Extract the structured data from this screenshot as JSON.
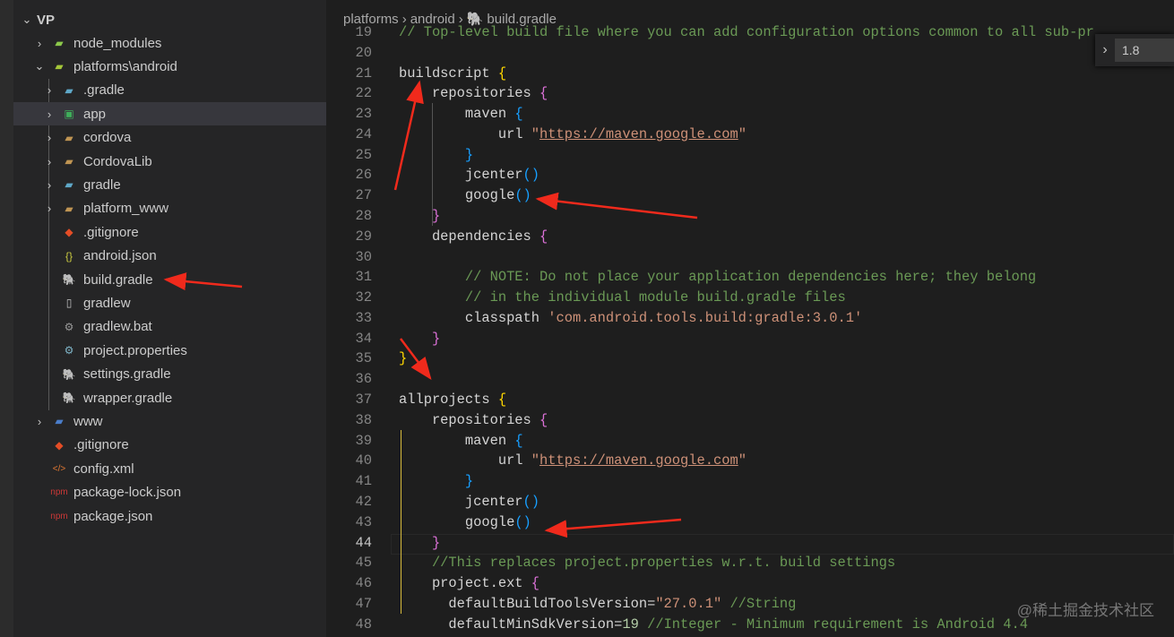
{
  "explorer": {
    "root": "VP",
    "items": [
      {
        "label": "node_modules",
        "icon": "node-folder-icon",
        "depth": 1,
        "expand": "closed"
      },
      {
        "label": "platforms\\android",
        "icon": "android-folder-icon",
        "depth": 1,
        "expand": "open"
      },
      {
        "label": ".gradle",
        "icon": "gradle-folder-icon",
        "depth": 2,
        "expand": "closed"
      },
      {
        "label": "app",
        "icon": "app-folder-icon",
        "depth": 2,
        "expand": "closed",
        "selected": true
      },
      {
        "label": "cordova",
        "icon": "folder-icon",
        "depth": 2,
        "expand": "closed"
      },
      {
        "label": "CordovaLib",
        "icon": "folder-icon",
        "depth": 2,
        "expand": "closed"
      },
      {
        "label": "gradle",
        "icon": "gradle-folder-icon",
        "depth": 2,
        "expand": "closed"
      },
      {
        "label": "platform_www",
        "icon": "folder-icon",
        "depth": 2,
        "expand": "closed"
      },
      {
        "label": ".gitignore",
        "icon": "git-icon",
        "depth": 2
      },
      {
        "label": "android.json",
        "icon": "json-icon",
        "depth": 2
      },
      {
        "label": "build.gradle",
        "icon": "gradle-file-icon",
        "depth": 2
      },
      {
        "label": "gradlew",
        "icon": "file-icon",
        "depth": 2
      },
      {
        "label": "gradlew.bat",
        "icon": "gears-icon",
        "depth": 2
      },
      {
        "label": "project.properties",
        "icon": "gear-icon",
        "depth": 2
      },
      {
        "label": "settings.gradle",
        "icon": "gradle-file-icon",
        "depth": 2
      },
      {
        "label": "wrapper.gradle",
        "icon": "gradle-file-icon",
        "depth": 2
      },
      {
        "label": "www",
        "icon": "www-folder-icon",
        "depth": 1,
        "expand": "closed"
      },
      {
        "label": ".gitignore",
        "icon": "git-icon",
        "depth": 1
      },
      {
        "label": "config.xml",
        "icon": "xml-icon",
        "depth": 1
      },
      {
        "label": "package-lock.json",
        "icon": "npm-icon",
        "depth": 1
      },
      {
        "label": "package.json",
        "icon": "npm-icon",
        "depth": 1
      }
    ]
  },
  "breadcrumb": [
    "platforms",
    "android",
    "build.gradle"
  ],
  "find": {
    "value": "1.8"
  },
  "watermark": "@稀土掘金技术社区",
  "editor": {
    "current_line": 44,
    "lines": [
      {
        "n": 19,
        "t": [
          [
            "c",
            "// Top-level build file where you can add configuration options common to all sub-pr"
          ]
        ]
      },
      {
        "n": 20,
        "t": []
      },
      {
        "n": 21,
        "t": [
          [
            "",
            "buildscript "
          ],
          [
            "b1",
            "{"
          ]
        ]
      },
      {
        "n": 22,
        "t": [
          [
            "",
            "    repositories "
          ],
          [
            "b2",
            "{"
          ]
        ]
      },
      {
        "n": 23,
        "t": [
          [
            "",
            "        maven "
          ],
          [
            "b3",
            "{"
          ]
        ]
      },
      {
        "n": 24,
        "t": [
          [
            "",
            "            url "
          ],
          [
            "s",
            "\""
          ],
          [
            "u",
            "https://maven.google.com"
          ],
          [
            "s",
            "\""
          ]
        ]
      },
      {
        "n": 25,
        "t": [
          [
            "",
            "        "
          ],
          [
            "b3",
            "}"
          ]
        ]
      },
      {
        "n": 26,
        "t": [
          [
            "",
            "        jcenter"
          ],
          [
            "b3",
            "()"
          ]
        ]
      },
      {
        "n": 27,
        "t": [
          [
            "",
            "        google"
          ],
          [
            "b3",
            "()"
          ]
        ]
      },
      {
        "n": 28,
        "t": [
          [
            "",
            "    "
          ],
          [
            "b2",
            "}"
          ]
        ]
      },
      {
        "n": 29,
        "t": [
          [
            "",
            "    dependencies "
          ],
          [
            "b2",
            "{"
          ]
        ]
      },
      {
        "n": 30,
        "t": []
      },
      {
        "n": 31,
        "t": [
          [
            "c",
            "        // NOTE: Do not place your application dependencies here; they belong"
          ]
        ]
      },
      {
        "n": 32,
        "t": [
          [
            "c",
            "        // in the individual module build.gradle files"
          ]
        ]
      },
      {
        "n": 33,
        "t": [
          [
            "",
            "        classpath "
          ],
          [
            "s",
            "'com.android.tools.build:gradle:3.0.1'"
          ]
        ]
      },
      {
        "n": 34,
        "t": [
          [
            "",
            "    "
          ],
          [
            "b2",
            "}"
          ]
        ]
      },
      {
        "n": 35,
        "t": [
          [
            "b1",
            "}"
          ]
        ]
      },
      {
        "n": 36,
        "t": []
      },
      {
        "n": 37,
        "t": [
          [
            "",
            "allprojects "
          ],
          [
            "b1",
            "{"
          ]
        ]
      },
      {
        "n": 38,
        "t": [
          [
            "",
            "    repositories "
          ],
          [
            "b2",
            "{"
          ]
        ]
      },
      {
        "n": 39,
        "t": [
          [
            "",
            "        maven "
          ],
          [
            "b3",
            "{"
          ]
        ]
      },
      {
        "n": 40,
        "t": [
          [
            "",
            "            url "
          ],
          [
            "s",
            "\""
          ],
          [
            "u",
            "https://maven.google.com"
          ],
          [
            "s",
            "\""
          ]
        ]
      },
      {
        "n": 41,
        "t": [
          [
            "",
            "        "
          ],
          [
            "b3",
            "}"
          ]
        ]
      },
      {
        "n": 42,
        "t": [
          [
            "",
            "        jcenter"
          ],
          [
            "b3",
            "()"
          ]
        ]
      },
      {
        "n": 43,
        "t": [
          [
            "",
            "        google"
          ],
          [
            "b3",
            "()"
          ]
        ]
      },
      {
        "n": 44,
        "t": [
          [
            "",
            "    "
          ],
          [
            "b2",
            "}"
          ]
        ]
      },
      {
        "n": 45,
        "t": [
          [
            "c",
            "    //This replaces project.properties w.r.t. build settings"
          ]
        ]
      },
      {
        "n": 46,
        "t": [
          [
            "",
            "    project.ext "
          ],
          [
            "b2",
            "{"
          ]
        ]
      },
      {
        "n": 47,
        "t": [
          [
            "",
            "      defaultBuildToolsVersion="
          ],
          [
            "s",
            "\"27.0.1\""
          ],
          [
            "c",
            " //String"
          ]
        ]
      },
      {
        "n": 48,
        "t": [
          [
            "",
            "      defaultMinSdkVersion="
          ],
          [
            "n",
            "19"
          ],
          [
            "c",
            " //Integer - Minimum requirement is Android 4.4"
          ]
        ]
      }
    ]
  }
}
